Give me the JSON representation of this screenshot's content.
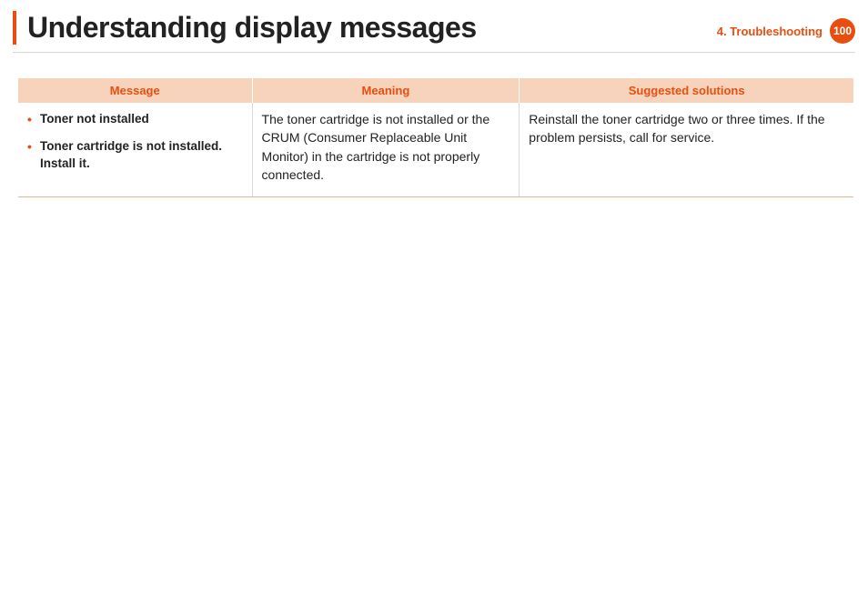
{
  "header": {
    "title": "Understanding display messages",
    "chapter": "4.  Troubleshooting",
    "page_number": "100"
  },
  "table": {
    "headers": {
      "message": "Message",
      "meaning": "Meaning",
      "solutions": "Suggested solutions"
    },
    "rows": [
      {
        "messages": [
          "Toner not installed",
          "Toner cartridge is not installed. Install it."
        ],
        "meaning": "The toner cartridge is not installed or the CRUM (Consumer Replaceable Unit Monitor) in the cartridge is not properly connected.",
        "solutions": "Reinstall the toner cartridge two or three times. If the problem persists, call for service."
      }
    ]
  }
}
